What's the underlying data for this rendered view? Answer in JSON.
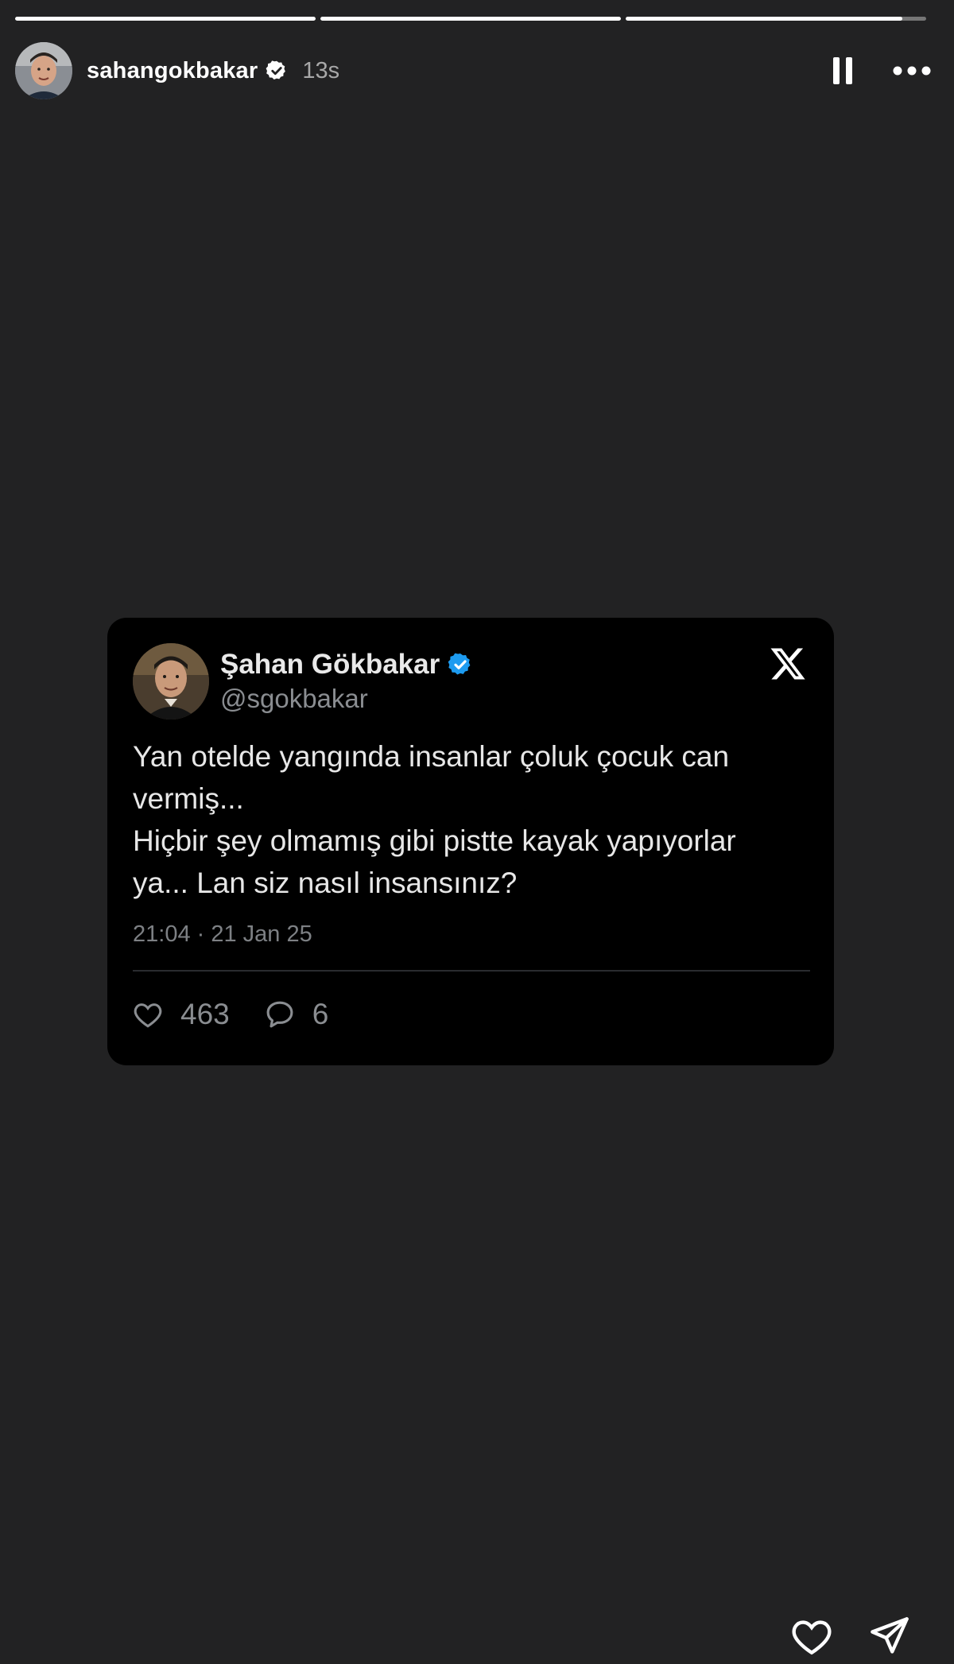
{
  "story": {
    "progress": [
      1.0,
      1.0,
      0.92
    ],
    "user": {
      "username": "sahangokbakar",
      "verified": true,
      "time": "13s"
    },
    "controls": {
      "pause_icon": "pause-icon",
      "more_icon": "more-horizontal-icon"
    },
    "actions": {
      "like_icon": "heart-icon",
      "share_icon": "send-icon"
    }
  },
  "tweet": {
    "name": "Şahan Gökbakar",
    "handle": "@sgokbakar",
    "verified": true,
    "text_lines": [
      "Yan otelde yangında insanlar çoluk çocuk can",
      "vermiş...",
      "Hiçbir şey olmamış gibi pistte kayak yapıyorlar",
      "ya... Lan siz nasıl insansınız?"
    ],
    "date": "21:04 · 21 Jan 25",
    "likes": "463",
    "replies": "6",
    "colors": {
      "card": "#000000",
      "verified_blue": "#1d9bf0"
    }
  },
  "colors": {
    "background": "#222223",
    "text": "#ffffff"
  }
}
